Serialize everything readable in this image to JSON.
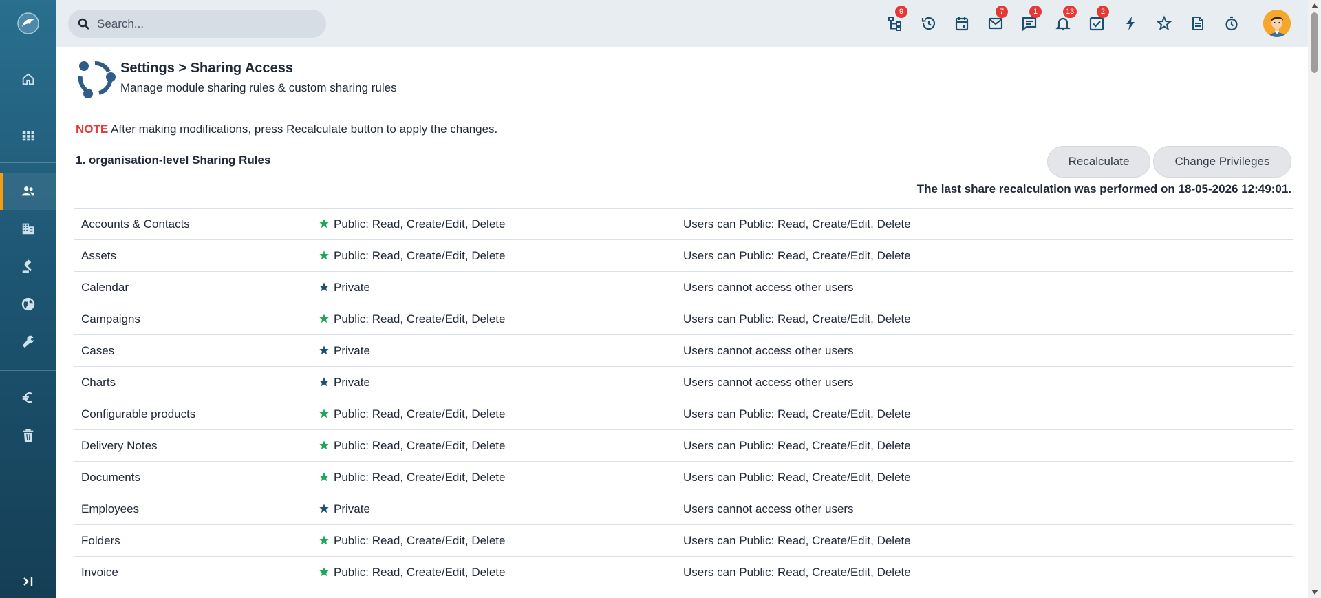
{
  "search": {
    "placeholder": "Search..."
  },
  "topbar": {
    "icons": [
      {
        "name": "hierarchy-icon",
        "badge": "9"
      },
      {
        "name": "history-icon",
        "badge": ""
      },
      {
        "name": "calendar-icon",
        "badge": ""
      },
      {
        "name": "mail-icon",
        "badge": "7"
      },
      {
        "name": "chat-icon",
        "badge": "1"
      },
      {
        "name": "bell-icon",
        "badge": "13"
      },
      {
        "name": "tasks-icon",
        "badge": "2"
      },
      {
        "name": "bolt-icon",
        "badge": ""
      },
      {
        "name": "star-icon",
        "badge": ""
      },
      {
        "name": "document-icon",
        "badge": ""
      },
      {
        "name": "timer-icon",
        "badge": ""
      }
    ]
  },
  "sidebar": {
    "items": [
      {
        "name": "home-icon"
      },
      {
        "name": "grid-icon"
      },
      {
        "name": "users-icon",
        "active": true
      },
      {
        "name": "building-icon"
      },
      {
        "name": "gavel-icon"
      },
      {
        "name": "globe-icon"
      },
      {
        "name": "wrench-icon"
      },
      {
        "name": "euro-icon"
      },
      {
        "name": "trash-icon"
      }
    ]
  },
  "header": {
    "title": "Settings > Sharing Access",
    "subtitle": "Manage module sharing rules & custom sharing rules"
  },
  "note": {
    "label": "NOTE",
    "text": "After making modifications, press Recalculate button to apply the changes."
  },
  "section": {
    "title": "1. organisation-level Sharing Rules",
    "recalculate_label": "Recalculate",
    "change_privileges_label": "Change Privileges",
    "last_recalculation": "The last share recalculation was performed on 18-05-2026 12:49:01."
  },
  "colors": {
    "public_star": "#22a559",
    "private_star": "#1d4f6e",
    "note_label": "#e53935",
    "active_indicator": "#f59e0b"
  },
  "rules": [
    {
      "module": "Accounts & Contacts",
      "access": "Public: Read, Create/Edit, Delete",
      "type": "public",
      "description": "Users can Public: Read, Create/Edit, Delete"
    },
    {
      "module": "Assets",
      "access": "Public: Read, Create/Edit, Delete",
      "type": "public",
      "description": "Users can Public: Read, Create/Edit, Delete"
    },
    {
      "module": "Calendar",
      "access": "Private",
      "type": "private",
      "description": "Users cannot access other users"
    },
    {
      "module": "Campaigns",
      "access": "Public: Read, Create/Edit, Delete",
      "type": "public",
      "description": "Users can Public: Read, Create/Edit, Delete"
    },
    {
      "module": "Cases",
      "access": "Private",
      "type": "private",
      "description": "Users cannot access other users"
    },
    {
      "module": "Charts",
      "access": "Private",
      "type": "private",
      "description": "Users cannot access other users"
    },
    {
      "module": "Configurable products",
      "access": "Public: Read, Create/Edit, Delete",
      "type": "public",
      "description": "Users can Public: Read, Create/Edit, Delete"
    },
    {
      "module": "Delivery Notes",
      "access": "Public: Read, Create/Edit, Delete",
      "type": "public",
      "description": "Users can Public: Read, Create/Edit, Delete"
    },
    {
      "module": "Documents",
      "access": "Public: Read, Create/Edit, Delete",
      "type": "public",
      "description": "Users can Public: Read, Create/Edit, Delete"
    },
    {
      "module": "Employees",
      "access": "Private",
      "type": "private",
      "description": "Users cannot access other users"
    },
    {
      "module": "Folders",
      "access": "Public: Read, Create/Edit, Delete",
      "type": "public",
      "description": "Users can Public: Read, Create/Edit, Delete"
    },
    {
      "module": "Invoice",
      "access": "Public: Read, Create/Edit, Delete",
      "type": "public",
      "description": "Users can Public: Read, Create/Edit, Delete"
    }
  ]
}
